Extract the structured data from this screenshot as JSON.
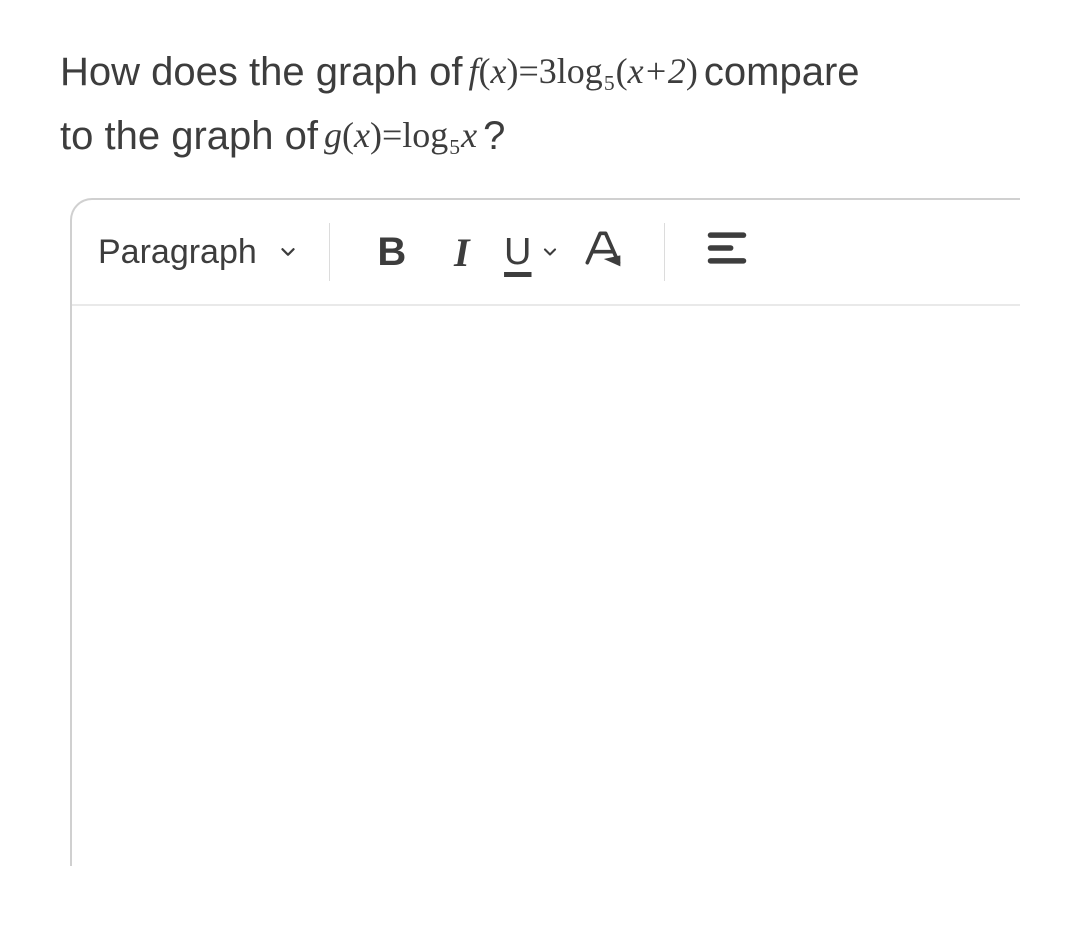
{
  "question": {
    "line1_prefix": "How does the graph of ",
    "formula_f": {
      "fn": "f",
      "arg": "x",
      "eq": " = ",
      "coef": "3",
      "log": "log",
      "base": "5",
      "paren_open": "(",
      "inner": "x+2",
      "paren_close": ")"
    },
    "line1_suffix": " compare",
    "line2_prefix": "to the graph of ",
    "formula_g": {
      "fn": "g",
      "arg": "x",
      "eq": " = ",
      "log": "log",
      "base": "5",
      "var": "x"
    },
    "line2_suffix": "?"
  },
  "toolbar": {
    "style_label": "Paragraph",
    "bold_glyph": "B",
    "italic_glyph": "I",
    "underline_glyph": "U"
  },
  "editor": {
    "content": ""
  }
}
